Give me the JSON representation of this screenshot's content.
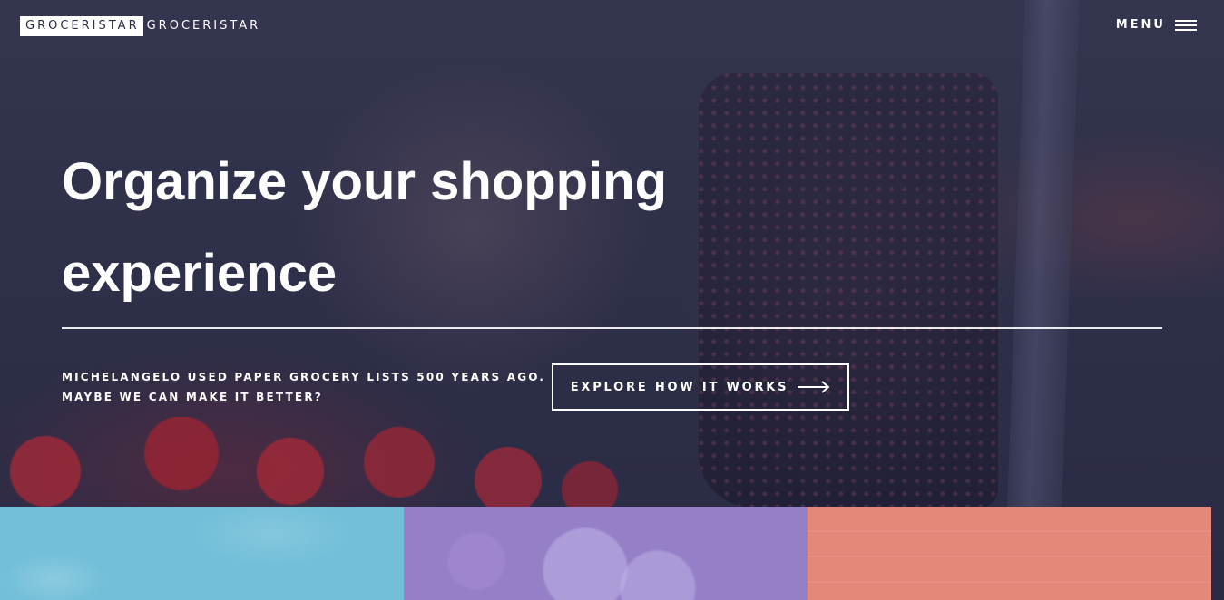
{
  "brand": {
    "logo_box_text": "GROCERISTAR",
    "logo_text": "GROCERISTAR"
  },
  "nav": {
    "menu_label": "MENU",
    "menu_icon": "hamburger-icon"
  },
  "hero": {
    "headline": "Organize your shopping experience",
    "tagline_line1": "MICHELANGELO USED PAPER GROCERY LISTS 500 YEARS AGO.",
    "tagline_line2": "MAYBE WE CAN MAKE IT BETTER?",
    "cta_label": "EXPLORE HOW IT WORKS",
    "cta_icon": "arrow-right-icon"
  },
  "colors": {
    "overlay": "#2b2c46",
    "text": "#ffffff",
    "tile_blue": "#73bfd9",
    "tile_purple": "#9580c8",
    "tile_coral": "#e4887a"
  }
}
